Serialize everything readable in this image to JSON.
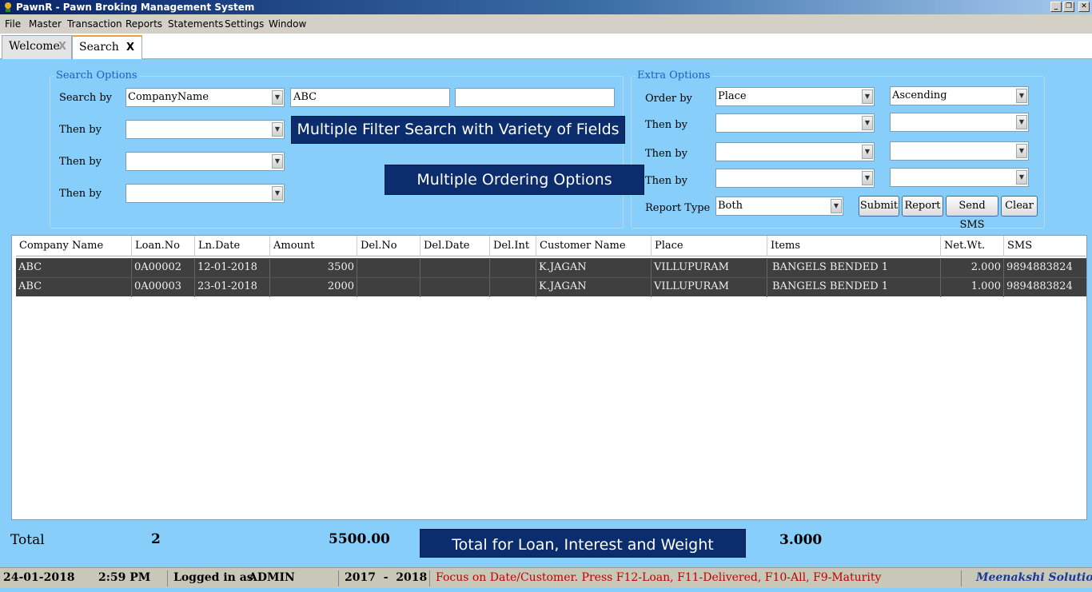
{
  "window": {
    "title": "PawnR - Pawn Broking Management System"
  },
  "menu": [
    "File",
    "Master",
    "Transaction",
    "Reports",
    "Statements",
    "Settings",
    "Window"
  ],
  "tabs": [
    {
      "label": "Welcome",
      "close": "X"
    },
    {
      "label": "Search",
      "close": "X"
    }
  ],
  "search_options": {
    "legend": "Search Options",
    "search_by_label": "Search by",
    "search_by_value": "CompanyName",
    "search_text_1": "ABC",
    "search_text_2": "",
    "then_by_label": "Then by",
    "then_by_1": "",
    "then_by_2": "",
    "then_by_3": ""
  },
  "extra_options": {
    "legend": "Extra Options",
    "order_by_label": "Order by",
    "order_by_value": "Place",
    "order_dir_value": "Ascending",
    "then_by_label": "Then by",
    "report_type_label": "Report Type",
    "report_type_value": "Both",
    "buttons": {
      "submit": "Submit",
      "report": "Report",
      "send_sms": "Send SMS",
      "clear": "Clear"
    }
  },
  "banners": {
    "filter": "Multiple Filter Search with Variety of Fields",
    "ordering": "Multiple Ordering Options",
    "totals": "Total for Loan, Interest and Weight"
  },
  "grid": {
    "columns": [
      "Company Name",
      "Loan.No",
      "Ln.Date",
      "Amount",
      "Del.No",
      "Del.Date",
      "Del.Int",
      "Customer Name",
      "Place",
      "Items",
      "Net.Wt.",
      "SMS"
    ],
    "rows": [
      [
        "ABC",
        "0A00002",
        "12-01-2018",
        "3500",
        "",
        "",
        "",
        "K.JAGAN",
        "VILLUPURAM",
        "BANGELS BENDED 1",
        "2.000",
        "9894883824"
      ],
      [
        "ABC",
        "0A00003",
        "23-01-2018",
        "2000",
        "",
        "",
        "",
        "K.JAGAN",
        "VILLUPURAM",
        "BANGELS BENDED 1",
        "1.000",
        "9894883824"
      ]
    ]
  },
  "totals": {
    "label": "Total",
    "count": "2",
    "amount": "5500.00",
    "weight": "3.000"
  },
  "status": {
    "date": "24-01-2018",
    "time": "2:59 PM",
    "logged_in_label": "Logged in as",
    "user": "ADMIN",
    "fin_year": "2017  -  2018",
    "hint": "Focus on Date/Customer. Press F12-Loan, F11-Delivered, F10-All, F9-Maturity",
    "company": "Meenakshi Solutions"
  },
  "colors": {
    "background": "#87CEFA",
    "banner": "#0b2d6e",
    "grid_row": "#3f3f3f",
    "hint_text": "#c00000",
    "company_text": "#1a3a9a"
  }
}
